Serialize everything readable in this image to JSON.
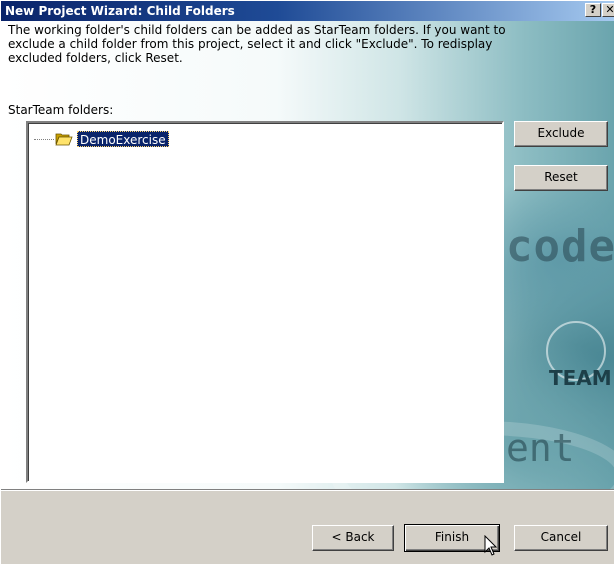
{
  "window": {
    "title": "New Project Wizard: Child Folders",
    "help_glyph": "?",
    "close_glyph": "✕"
  },
  "description": {
    "line1": "The working folder's child folders can be added as StarTeam folders. If you want to",
    "line2": "exclude a child folder from this project, select it and click \"Exclude\". To redisplay",
    "line3": "excluded folders, click Reset."
  },
  "tree": {
    "label": "StarTeam folders:",
    "items": [
      {
        "label": "DemoExercise",
        "selected": true,
        "icon": "open-folder-icon"
      }
    ]
  },
  "side_buttons": {
    "exclude": "Exclude",
    "reset": "Reset"
  },
  "background_art": {
    "code": "code",
    "team": "TEAM",
    "ent": "ent"
  },
  "footer": {
    "back": "< Back",
    "finish": "Finish",
    "cancel": "Cancel"
  },
  "colors": {
    "titlebar_start": "#0a246a",
    "titlebar_end": "#a6caf0",
    "selection": "#0a246a",
    "dialog_face": "#d4d0c8",
    "art_teal": "#6aa4ad"
  }
}
